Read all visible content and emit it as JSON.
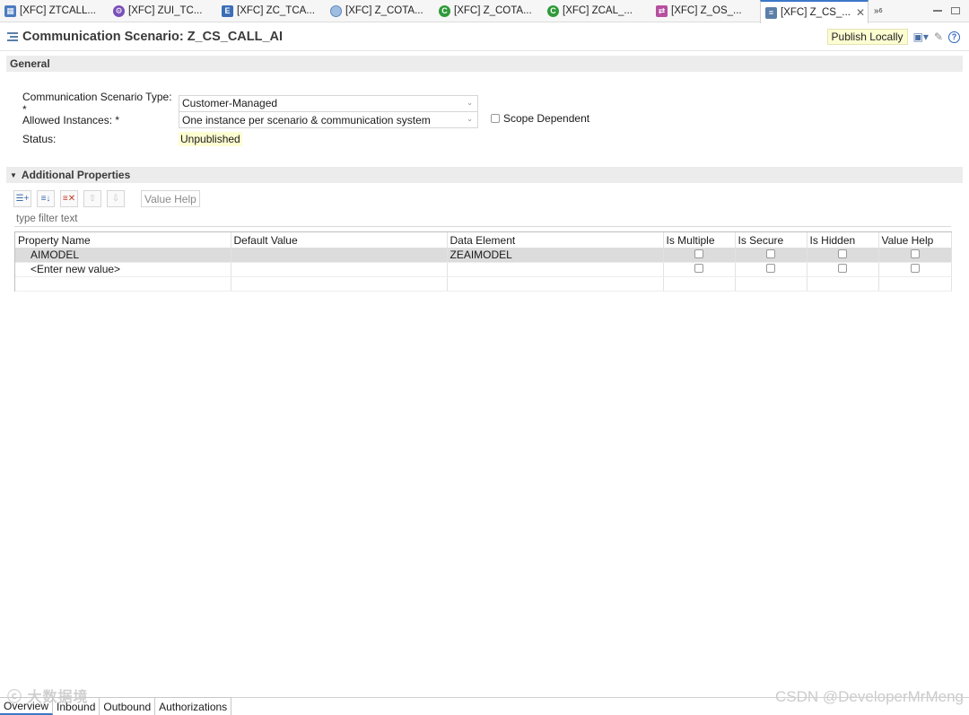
{
  "tabs": [
    {
      "label": "[XFC] ZTCALL...",
      "icon": "table-icon",
      "color": "#4c7bbf",
      "glyph": "▦"
    },
    {
      "label": "[XFC] ZUI_TC...",
      "icon": "service-binding-icon",
      "color": "#7a4fb8",
      "glyph": "⚙"
    },
    {
      "label": "[XFC] ZC_TCA...",
      "icon": "entity-icon",
      "color": "#3b6fb6",
      "glyph": "E"
    },
    {
      "label": "[XFC] Z_COTA...",
      "icon": "interface-icon",
      "color": "#7ea6d6",
      "glyph": ""
    },
    {
      "label": "[XFC] Z_COTA...",
      "icon": "class-icon",
      "color": "#2f9a3a",
      "glyph": "C"
    },
    {
      "label": "[XFC] ZCAL_...",
      "icon": "class-icon",
      "color": "#2f9a3a",
      "glyph": "C"
    },
    {
      "label": "[XFC] Z_OS_...",
      "icon": "outbound-service-icon",
      "color": "#b64fa0",
      "glyph": "⇄"
    },
    {
      "label": "[XFC] Z_CS_...",
      "icon": "communication-scenario-icon",
      "color": "#5b7fa8",
      "glyph": "≡",
      "active": true
    }
  ],
  "tab_overflow": "»",
  "tab_overflow_count": "6",
  "header": {
    "title": "Communication Scenario: Z_CS_CALL_AI",
    "publish_label": "Publish Locally"
  },
  "general": {
    "section_title": "General",
    "type_label": "Communication Scenario Type: *",
    "type_value": "Customer-Managed",
    "instances_label": "Allowed Instances: *",
    "instances_value": "One instance per scenario & communication system",
    "status_label": "Status:",
    "status_value": "Unpublished",
    "scope_label": "Scope Dependent"
  },
  "additional": {
    "section_title": "Additional Properties",
    "value_help_button": "Value Help",
    "filter_placeholder": "type filter text",
    "columns": [
      "Property Name",
      "Default Value",
      "Data Element",
      "Is Multiple",
      "Is Secure",
      "Is Hidden",
      "Value Help"
    ],
    "rows": [
      {
        "property": "AIMODEL",
        "default": "",
        "data_element": "ZEAIMODEL"
      },
      {
        "property": "<Enter new value>",
        "default": "",
        "data_element": ""
      }
    ]
  },
  "page_tabs": [
    "Overview",
    "Inbound",
    "Outbound",
    "Authorizations"
  ],
  "watermarks": {
    "left": "ⓒ 大数据境",
    "right": "CSDN @DeveloperMrMeng"
  }
}
